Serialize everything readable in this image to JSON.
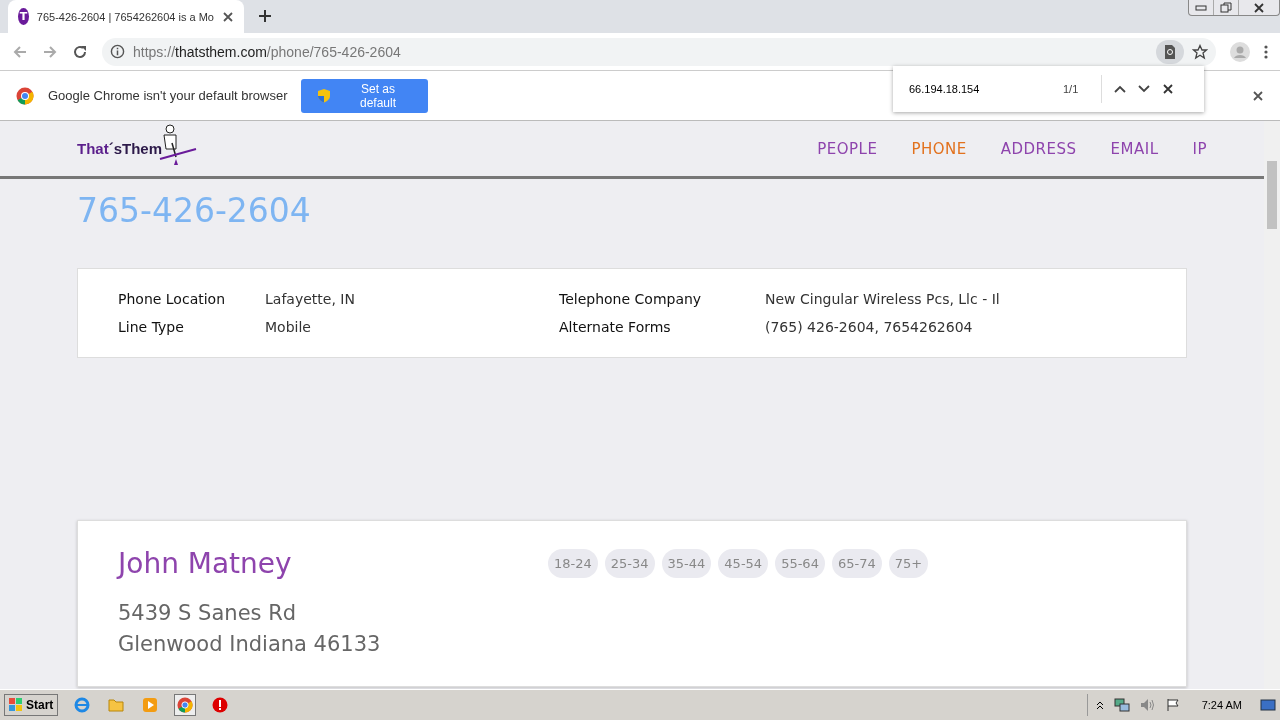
{
  "tab": {
    "title": "765-426-2604 | 7654262604 is a Mo",
    "favicon_letter": "T"
  },
  "address_bar": {
    "scheme": "https://",
    "host": "thatsthem.com",
    "path": "/phone/765-426-2604"
  },
  "infobar": {
    "message": "Google Chrome isn't your default browser",
    "button": "Set as default"
  },
  "find_bar": {
    "query": "66.194.18.154",
    "count": "1/1"
  },
  "site": {
    "logo_a": "That",
    "logo_b": "´s",
    "logo_c": "Them",
    "nav": [
      {
        "label": "PEOPLE",
        "selected": false
      },
      {
        "label": "PHONE",
        "selected": true
      },
      {
        "label": "ADDRESS",
        "selected": false
      },
      {
        "label": "EMAIL",
        "selected": false
      },
      {
        "label": "IP",
        "selected": false
      }
    ]
  },
  "phone_number": "765-426-2604",
  "details": [
    {
      "label": "Phone Location",
      "value": "Lafayette, IN"
    },
    {
      "label": "Telephone Company",
      "value": "New Cingular Wireless Pcs, Llc - Il"
    },
    {
      "label": "Line Type",
      "value": "Mobile"
    },
    {
      "label": "Alternate Forms",
      "value": "(765) 426-2604, 7654262604"
    }
  ],
  "person": {
    "name": "John Matney",
    "address_lines": [
      "5439 S Sanes Rd",
      "Glenwood Indiana 46133"
    ],
    "age_ranges": [
      "18-24",
      "25-34",
      "35-44",
      "45-54",
      "55-64",
      "65-74",
      "75+"
    ]
  },
  "taskbar": {
    "start": "Start",
    "time": "7:24 AM"
  }
}
